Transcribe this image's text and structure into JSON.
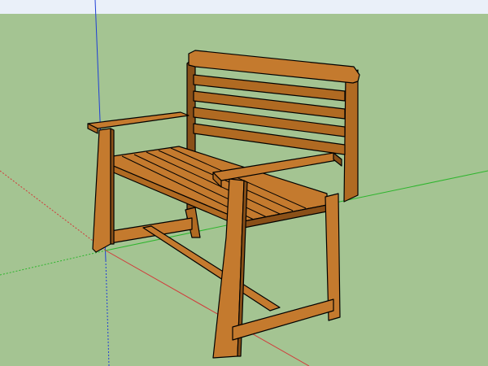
{
  "scene": {
    "sky_color": "#eaf0f9",
    "ground_color": "#a4c492",
    "axis_colors": {
      "green": "#2db52d",
      "red": "#d23a3a",
      "blue": "#1f3fd6"
    }
  },
  "model": {
    "wood_light": "#c47a2e",
    "wood_mid": "#b06a22",
    "wood_dark": "#8a5018",
    "edge": "#000000"
  }
}
